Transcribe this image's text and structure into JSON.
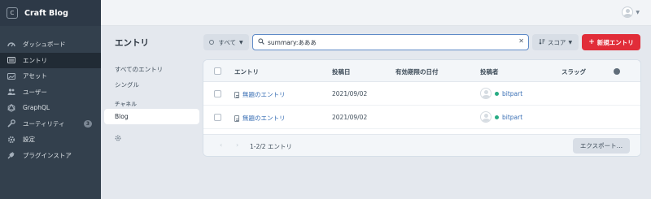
{
  "app": {
    "logo_letter": "C",
    "name": "Craft Blog"
  },
  "nav": {
    "items": [
      {
        "label": "ダッシュボード",
        "icon": "dashboard-icon"
      },
      {
        "label": "エントリ",
        "icon": "entries-icon",
        "active": true
      },
      {
        "label": "アセット",
        "icon": "assets-icon"
      },
      {
        "label": "ユーザー",
        "icon": "users-icon"
      },
      {
        "label": "GraphQL",
        "icon": "graphql-icon"
      },
      {
        "label": "ユーティリティ",
        "icon": "wrench-icon",
        "badge": "3"
      },
      {
        "label": "設定",
        "icon": "gear-icon"
      },
      {
        "label": "プラグインストア",
        "icon": "plug-icon"
      }
    ]
  },
  "page": {
    "title": "エントリ"
  },
  "toolbar": {
    "status_filter": "すべて",
    "search_value": "summary:あああ",
    "sort_label": "スコア",
    "new_button": "新規エントリ"
  },
  "sources": {
    "all": "すべてのエントリ",
    "singles": "シングル",
    "channels_heading": "チャネル",
    "selected": "Blog"
  },
  "table": {
    "headers": {
      "title": "エントリ",
      "post_date": "投稿日",
      "expiry_date": "有効期限の日付",
      "author": "投稿者",
      "slug": "スラッグ"
    },
    "rows": [
      {
        "title": "無題のエントリ",
        "post_date": "2021/09/02",
        "author": "bitpart"
      },
      {
        "title": "無題のエントリ",
        "post_date": "2021/09/02",
        "author": "bitpart"
      }
    ],
    "pagination": "1-2/2 エントリ",
    "export_button": "エクスポート…"
  },
  "colors": {
    "accent": "#e12d39",
    "link": "#3b70b5",
    "status_live": "#27ab83",
    "sidebar_bg": "#33404d"
  }
}
